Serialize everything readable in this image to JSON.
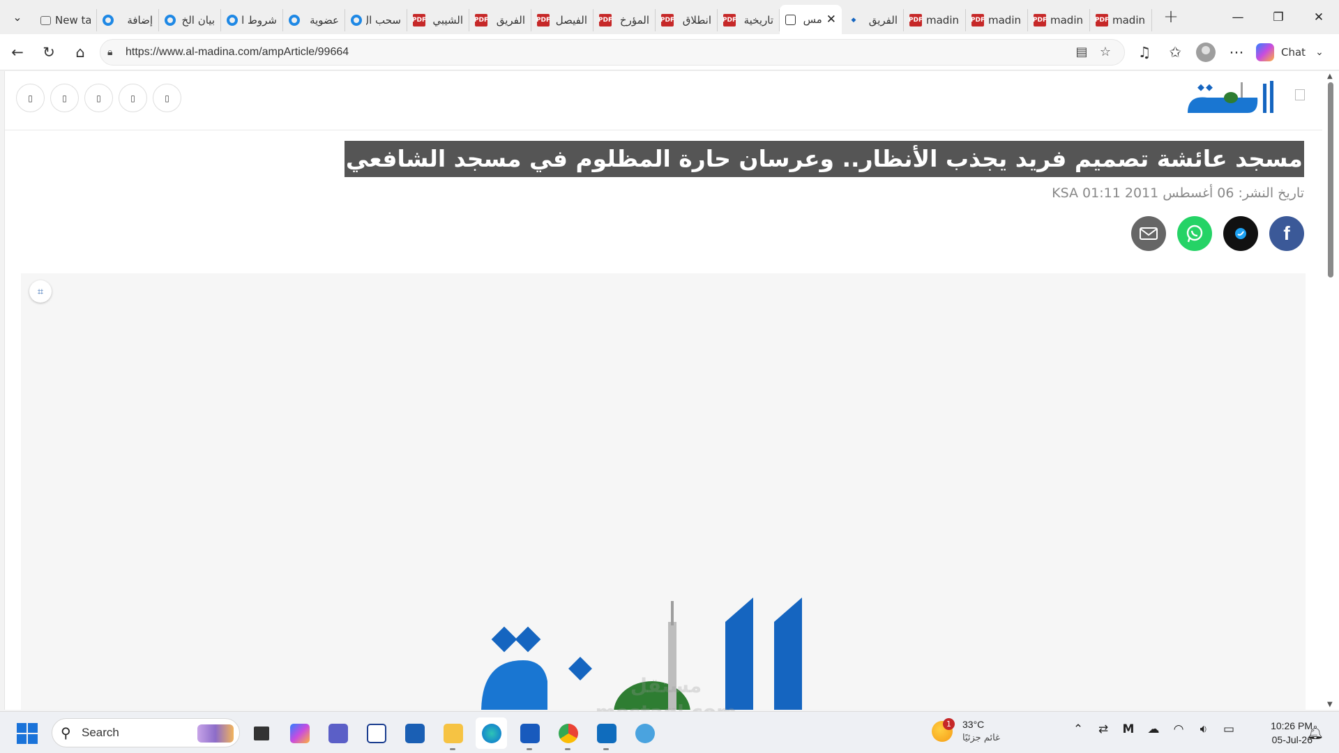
{
  "browser": {
    "tabs": [
      {
        "title": "New ta",
        "icon": "newtab-icon",
        "ltr": true
      },
      {
        "title": "إضافة",
        "icon": "site-circle-icon"
      },
      {
        "title": "بيان الخ",
        "icon": "site-circle-icon"
      },
      {
        "title": "شروط ال",
        "icon": "site-circle-icon"
      },
      {
        "title": "عضوية",
        "icon": "site-circle-icon"
      },
      {
        "title": "سحب ال",
        "icon": "site-circle-icon"
      },
      {
        "title": "الشيبي",
        "icon": "pdf-icon"
      },
      {
        "title": "الفريق",
        "icon": "pdf-icon"
      },
      {
        "title": "الفيصل",
        "icon": "pdf-icon"
      },
      {
        "title": "المؤرخ",
        "icon": "pdf-icon"
      },
      {
        "title": "انطلاق",
        "icon": "pdf-icon"
      },
      {
        "title": "تاريخية",
        "icon": "pdf-icon"
      },
      {
        "title": "مس",
        "icon": "page-icon",
        "active": true
      },
      {
        "title": "الفريق",
        "icon": "madina-favicon"
      },
      {
        "title": "madina",
        "icon": "pdf-icon",
        "ltr": true
      },
      {
        "title": "madina",
        "icon": "pdf-icon",
        "ltr": true
      },
      {
        "title": "madina",
        "icon": "pdf-icon",
        "ltr": true
      },
      {
        "title": "madina",
        "icon": "pdf-icon",
        "ltr": true
      }
    ],
    "url": "https://www.al-madina.com/ampArticle/99664",
    "chat_label": "Chat"
  },
  "site": {
    "logo_text": "المدينة"
  },
  "article": {
    "title": "مسجد عائشة تصميم فريد يجذب الأنظار.. وعرسان حارة المظلوم في مسجد الشافعي",
    "pub_date": "تاريخ النشر: 06 أغسطس 2011 01:11 KSA"
  },
  "watermark": {
    "line1": "مستقل",
    "line2": "mostaql.com"
  },
  "taskbar": {
    "search_label": "Search",
    "weather_temp": "33°C",
    "weather_condition": "غائم جزئيًا",
    "weather_alerts": "1",
    "time": "10:26 PM",
    "date": "05-Jul-26"
  },
  "colors": {
    "title_highlight": "#555555",
    "facebook": "#3b5998",
    "whatsapp": "#25d366",
    "logo_blue": "#1565c0"
  }
}
